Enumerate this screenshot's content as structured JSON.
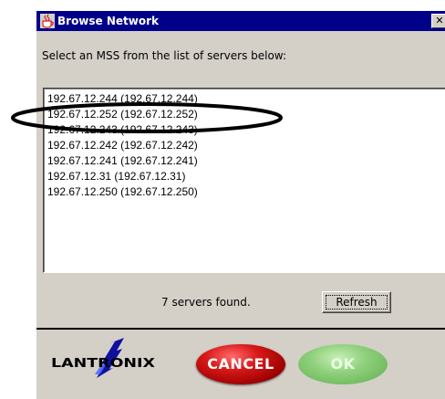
{
  "window": {
    "title": "Browse Network",
    "close_glyph": "✕"
  },
  "prompt": "Select an MSS from the list of servers below:",
  "servers": [
    "192.67.12.244 (192.67.12.244)",
    "192.67.12.252 (192.67.12.252)",
    "192.67.12.243 (192.67.12.243)",
    "192.67.12.242 (192.67.12.242)",
    "192.67.12.241 (192.67.12.241)",
    "192.67.12.31 (192.67.12.31)",
    "192.67.12.250 (192.67.12.250)"
  ],
  "status": "7 servers found.",
  "refresh_label": "Refresh",
  "logo_text": "LANTRONIX",
  "cancel_label": "CANCEL",
  "ok_label": "OK",
  "colors": {
    "titlebar": "#000088",
    "cancel": "#c00000",
    "ok": "#8fd07c"
  }
}
